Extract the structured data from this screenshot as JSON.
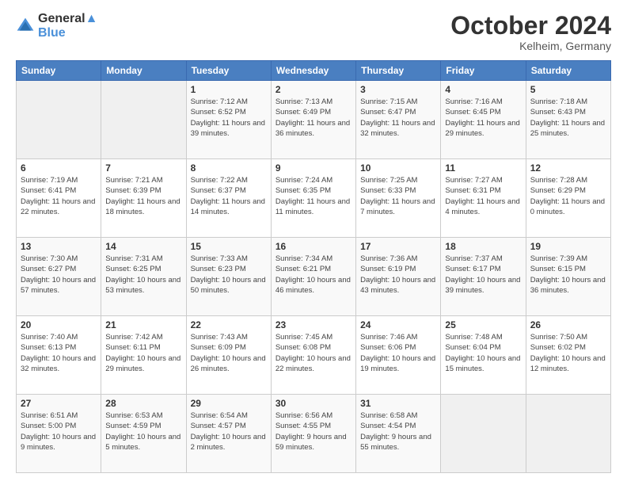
{
  "header": {
    "logo_line1": "General",
    "logo_line2": "Blue",
    "month_title": "October 2024",
    "location": "Kelheim, Germany"
  },
  "weekdays": [
    "Sunday",
    "Monday",
    "Tuesday",
    "Wednesday",
    "Thursday",
    "Friday",
    "Saturday"
  ],
  "weeks": [
    [
      {
        "day": "",
        "info": ""
      },
      {
        "day": "",
        "info": ""
      },
      {
        "day": "1",
        "info": "Sunrise: 7:12 AM\nSunset: 6:52 PM\nDaylight: 11 hours and 39 minutes."
      },
      {
        "day": "2",
        "info": "Sunrise: 7:13 AM\nSunset: 6:49 PM\nDaylight: 11 hours and 36 minutes."
      },
      {
        "day": "3",
        "info": "Sunrise: 7:15 AM\nSunset: 6:47 PM\nDaylight: 11 hours and 32 minutes."
      },
      {
        "day": "4",
        "info": "Sunrise: 7:16 AM\nSunset: 6:45 PM\nDaylight: 11 hours and 29 minutes."
      },
      {
        "day": "5",
        "info": "Sunrise: 7:18 AM\nSunset: 6:43 PM\nDaylight: 11 hours and 25 minutes."
      }
    ],
    [
      {
        "day": "6",
        "info": "Sunrise: 7:19 AM\nSunset: 6:41 PM\nDaylight: 11 hours and 22 minutes."
      },
      {
        "day": "7",
        "info": "Sunrise: 7:21 AM\nSunset: 6:39 PM\nDaylight: 11 hours and 18 minutes."
      },
      {
        "day": "8",
        "info": "Sunrise: 7:22 AM\nSunset: 6:37 PM\nDaylight: 11 hours and 14 minutes."
      },
      {
        "day": "9",
        "info": "Sunrise: 7:24 AM\nSunset: 6:35 PM\nDaylight: 11 hours and 11 minutes."
      },
      {
        "day": "10",
        "info": "Sunrise: 7:25 AM\nSunset: 6:33 PM\nDaylight: 11 hours and 7 minutes."
      },
      {
        "day": "11",
        "info": "Sunrise: 7:27 AM\nSunset: 6:31 PM\nDaylight: 11 hours and 4 minutes."
      },
      {
        "day": "12",
        "info": "Sunrise: 7:28 AM\nSunset: 6:29 PM\nDaylight: 11 hours and 0 minutes."
      }
    ],
    [
      {
        "day": "13",
        "info": "Sunrise: 7:30 AM\nSunset: 6:27 PM\nDaylight: 10 hours and 57 minutes."
      },
      {
        "day": "14",
        "info": "Sunrise: 7:31 AM\nSunset: 6:25 PM\nDaylight: 10 hours and 53 minutes."
      },
      {
        "day": "15",
        "info": "Sunrise: 7:33 AM\nSunset: 6:23 PM\nDaylight: 10 hours and 50 minutes."
      },
      {
        "day": "16",
        "info": "Sunrise: 7:34 AM\nSunset: 6:21 PM\nDaylight: 10 hours and 46 minutes."
      },
      {
        "day": "17",
        "info": "Sunrise: 7:36 AM\nSunset: 6:19 PM\nDaylight: 10 hours and 43 minutes."
      },
      {
        "day": "18",
        "info": "Sunrise: 7:37 AM\nSunset: 6:17 PM\nDaylight: 10 hours and 39 minutes."
      },
      {
        "day": "19",
        "info": "Sunrise: 7:39 AM\nSunset: 6:15 PM\nDaylight: 10 hours and 36 minutes."
      }
    ],
    [
      {
        "day": "20",
        "info": "Sunrise: 7:40 AM\nSunset: 6:13 PM\nDaylight: 10 hours and 32 minutes."
      },
      {
        "day": "21",
        "info": "Sunrise: 7:42 AM\nSunset: 6:11 PM\nDaylight: 10 hours and 29 minutes."
      },
      {
        "day": "22",
        "info": "Sunrise: 7:43 AM\nSunset: 6:09 PM\nDaylight: 10 hours and 26 minutes."
      },
      {
        "day": "23",
        "info": "Sunrise: 7:45 AM\nSunset: 6:08 PM\nDaylight: 10 hours and 22 minutes."
      },
      {
        "day": "24",
        "info": "Sunrise: 7:46 AM\nSunset: 6:06 PM\nDaylight: 10 hours and 19 minutes."
      },
      {
        "day": "25",
        "info": "Sunrise: 7:48 AM\nSunset: 6:04 PM\nDaylight: 10 hours and 15 minutes."
      },
      {
        "day": "26",
        "info": "Sunrise: 7:50 AM\nSunset: 6:02 PM\nDaylight: 10 hours and 12 minutes."
      }
    ],
    [
      {
        "day": "27",
        "info": "Sunrise: 6:51 AM\nSunset: 5:00 PM\nDaylight: 10 hours and 9 minutes."
      },
      {
        "day": "28",
        "info": "Sunrise: 6:53 AM\nSunset: 4:59 PM\nDaylight: 10 hours and 5 minutes."
      },
      {
        "day": "29",
        "info": "Sunrise: 6:54 AM\nSunset: 4:57 PM\nDaylight: 10 hours and 2 minutes."
      },
      {
        "day": "30",
        "info": "Sunrise: 6:56 AM\nSunset: 4:55 PM\nDaylight: 9 hours and 59 minutes."
      },
      {
        "day": "31",
        "info": "Sunrise: 6:58 AM\nSunset: 4:54 PM\nDaylight: 9 hours and 55 minutes."
      },
      {
        "day": "",
        "info": ""
      },
      {
        "day": "",
        "info": ""
      }
    ]
  ]
}
